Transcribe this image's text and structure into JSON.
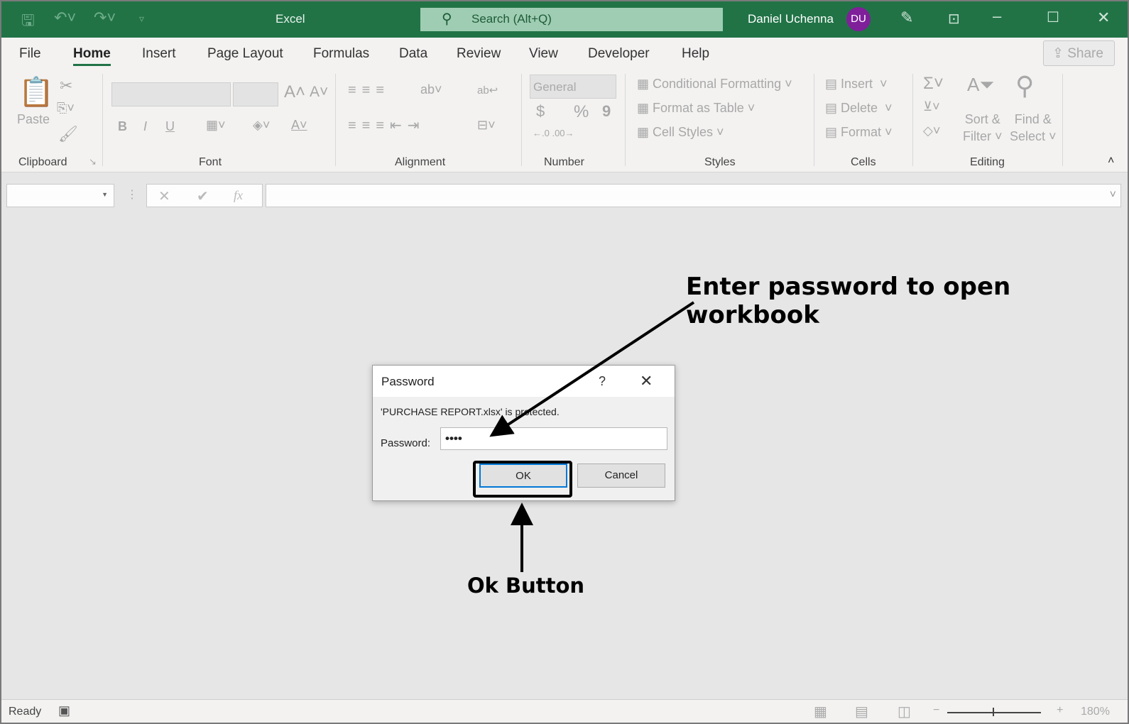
{
  "titlebar": {
    "app_title": "Excel",
    "search_placeholder": "Search (Alt+Q)",
    "user_name": "Daniel Uchenna",
    "user_initials": "DU"
  },
  "tabs": [
    "File",
    "Home",
    "Insert",
    "Page Layout",
    "Formulas",
    "Data",
    "Review",
    "View",
    "Developer",
    "Help"
  ],
  "active_tab": "Home",
  "share_label": "Share",
  "ribbon": {
    "clipboard": {
      "paste": "Paste",
      "group": "Clipboard"
    },
    "font": {
      "bold": "B",
      "italic": "I",
      "underline": "U",
      "group": "Font"
    },
    "alignment": {
      "group": "Alignment"
    },
    "number": {
      "format": "General",
      "currency": "$",
      "percent": "%",
      "comma": "9",
      "group": "Number"
    },
    "styles": {
      "conditional": "Conditional Formatting",
      "format_table": "Format as Table",
      "cell_styles": "Cell Styles",
      "group": "Styles"
    },
    "cells": {
      "insert": "Insert",
      "delete": "Delete",
      "format": "Format",
      "group": "Cells"
    },
    "editing": {
      "sort1": "Sort &",
      "sort2": "Filter",
      "find1": "Find &",
      "find2": "Select",
      "group": "Editing"
    }
  },
  "formula_bar": {
    "fx": "fx"
  },
  "status": {
    "ready": "Ready",
    "zoom": "180%",
    "zoom_level_percent": 180
  },
  "dialog": {
    "title": "Password",
    "help": "?",
    "message": "'PURCHASE REPORT.xlsx' is protected.",
    "password_label": "Password:",
    "password_value": "••••",
    "ok": "OK",
    "cancel": "Cancel"
  },
  "annotations": {
    "top": "Enter password to open workbook",
    "bottom": "Ok Button"
  },
  "colors": {
    "brand": "#217346",
    "avatar": "#7f1f9a",
    "focus": "#0078d7"
  }
}
